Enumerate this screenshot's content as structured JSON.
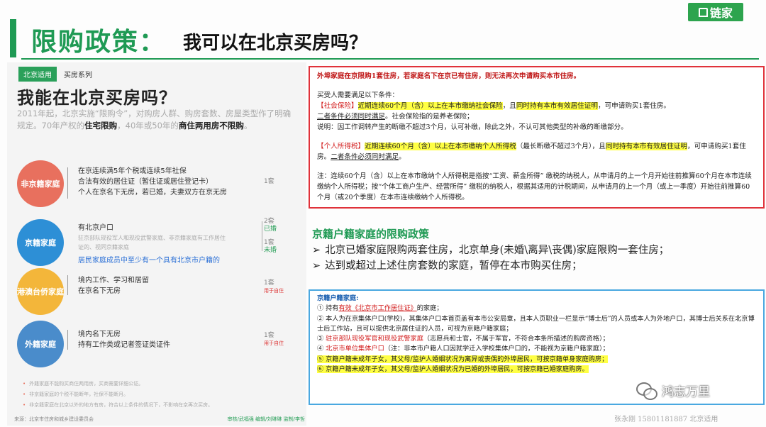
{
  "header": {
    "title": "限购政策：",
    "subtitle": "我可以在北京买房吗？",
    "logo": "链家"
  },
  "left_panel": {
    "tags": [
      "北京适用",
      "买房系列"
    ],
    "title": "我能在北京买房吗？",
    "intro_plain": "2011年起，北京实施“限购令”，对购房人群、购房套数、房屋类型作了明确规定。70年产权的",
    "intro_bold1": "住宅限购",
    "intro_mid": "，40年或50年的",
    "intro_bold2": "商住两用房不限购",
    "intro_end": "。",
    "groups": [
      {
        "label": "非京籍家庭",
        "conditions": [
          "在京连续满5年个税或连续5年社保",
          "合法有效的居住证（暂住证或居住登记卡）",
          "个人在京名下无房，若已婚，夫妻双方在京无房"
        ],
        "count": "1套"
      },
      {
        "label": "京籍家庭",
        "conditions": [
          "有北京户口"
        ],
        "notes": [
          "驻京部队现役军人和现役武警家庭、非京籍家庭有工作居住",
          "证的、视同京籍家庭"
        ],
        "count_a": "2套",
        "count_a_note": "已婚",
        "count_b": "1套",
        "count_b_note": "未婚"
      },
      {
        "label": "港澳台侨家庭",
        "conditions": [
          "境内工作、学习和居留",
          "在京名下无房"
        ],
        "count": "1套",
        "count_note": "用于自住"
      },
      {
        "label": "外籍家庭",
        "conditions": [
          "境内名下无房",
          "持有工作类或记者签证类证件"
        ],
        "count": "1套",
        "count_note": "用于自住"
      }
    ],
    "handwritten_note": "居民家庭成员中至少有一个具有北京市户籍的",
    "bullets": [
      "外籍家庭不能购买商住两用房，买商需要详细公证。",
      "非京籍家庭的个税不能断年，社保不能断月。",
      "非京籍家庭在北京以外的地方有房，符合以上条件的情况下，不影响在京再次买房。"
    ],
    "footer_source": "来源：北京市住房和城乡建设委员会",
    "footer_credits": "审核/武福强  编辑/刘琳琳  监制/李哲"
  },
  "red_box": {
    "heading": "外埠家庭在京限购1套住房，若家庭名下在京已有住房，则无法再次申请购买本市住房。",
    "requirement_intro": "买受人需要满足以下条件：",
    "social_tag": "【社会保险】",
    "social_hl": "近期连续60个月（含）以上在本市缴纳社会保险",
    "social_mid": "，且",
    "social_hl2": "同时持有本市有效居住证明",
    "social_end": "，可申请购买1套住房。",
    "social_line2": "二者条件必须同时满足",
    "social_line2_end": "。社会保险指的是养老保险；",
    "explain": "说明：因工作调转产生的断缴不超过3个月，认可补缴，除此之外，不认可其他类型的补缴的断缴部分。",
    "tax_tag": "【个人所得税】",
    "tax_hl": "近期连续60个月（含）以上在本市缴纳个人所得税",
    "tax_mid": "（最长断缴不超过3个月），且",
    "tax_hl2": "同时持有本市有效居住证明",
    "tax_end": "，可申请购买1套住房。",
    "tax_line2": "二者条件必须同时满足",
    "tax_line2_end": "。",
    "note": "注：连续60个月（含）以上在本市缴纳个人所得税是指按“工资、薪金所得” 缴税的纳税人，从申请月的上一个月开始往前推算60个月在本市连续缴纳个人所得税；按“个体工商户生产、经营所得” 缴税的纳税人，根据其适用的计税期间，从申请月的上一个月（或上一季度）开始往前推算60个月（或20个季度）在本市连续缴纳个人所得税。"
  },
  "beijing_section": {
    "title": "京籍户籍家庭的限购政策",
    "points": [
      "北京已婚家庭限购两套住房，北京单身(未婚\\离异\\丧偶)家庭限购一套住房；",
      "达到或超过上述住房套数的家庭，暂停在本市购买住房；"
    ]
  },
  "blue_box": {
    "heading": "京籍户籍家庭:",
    "item1_pre": "① 持有",
    "item1_red": "有效《北京市工作居住证》",
    "item1_end": "的家庭；",
    "item2": "② 本人为在京集体户口(学校)，其集体户口本首页盖有本市公安局章，且本人页职业一栏显示“博士后”的人员或本人为外地户口，其博士后关系在北京博士后工作站，且可以提供北京居住证的人员，可视为京籍户籍家庭；",
    "item3_pre": "③ ",
    "item3_red": "驻京部队现役军官和现役武警家庭",
    "item3_end": "（志愿兵和士官，不属于军官，不符合本条所描述的购房资格）；",
    "item4_pre": "④ ",
    "item4_red": "北京市单位集体户口",
    "item4_end": "（注：非本市户籍人口因就学迁入学校集体户口的，不能视为京籍户籍家庭）；",
    "item5": "⑤ 京籍户籍未成年子女，其父母/监护人婚姻状况为离异或丧偶的外埠居民，可按京籍单身家庭购房；",
    "item6": "⑥ 京籍户籍未成年子女，其父母/监护人婚姻状况为已婚的外埠居民，可按京籍已婚家庭购房。"
  },
  "watermark": "鸿志万里",
  "footer_contact": "张永刚  15801181887  北京适用"
}
